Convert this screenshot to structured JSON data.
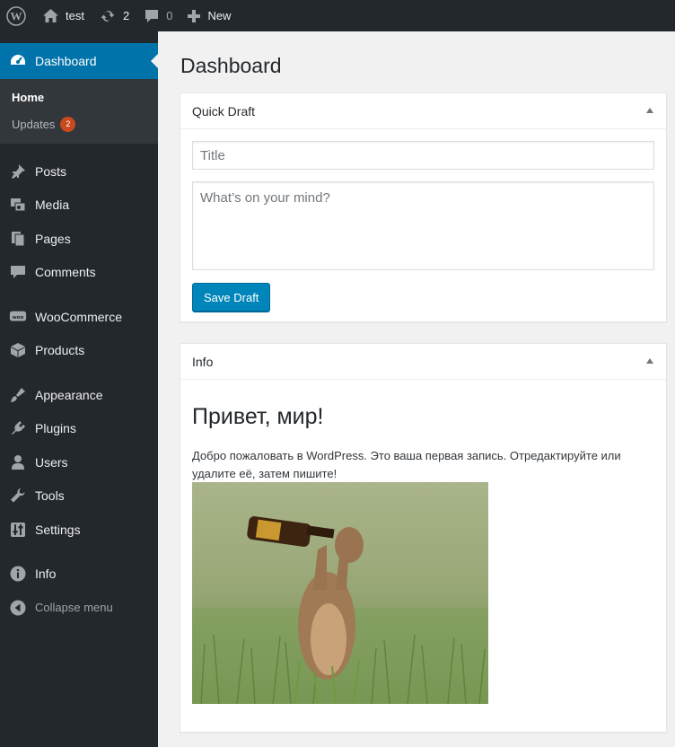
{
  "admin_bar": {
    "site_name": "test",
    "updates_count": "2",
    "comments_count": "0",
    "new_label": "New"
  },
  "sidebar": {
    "dashboard": "Dashboard",
    "submenu": {
      "home": "Home",
      "updates": "Updates",
      "updates_badge": "2"
    },
    "items": [
      {
        "label": "Posts",
        "icon": "pin-icon"
      },
      {
        "label": "Media",
        "icon": "media-icon"
      },
      {
        "label": "Pages",
        "icon": "pages-icon"
      },
      {
        "label": "Comments",
        "icon": "comments-icon"
      },
      {
        "label": "WooCommerce",
        "icon": "woocommerce-icon"
      },
      {
        "label": "Products",
        "icon": "products-icon"
      },
      {
        "label": "Appearance",
        "icon": "brush-icon"
      },
      {
        "label": "Plugins",
        "icon": "plugin-icon"
      },
      {
        "label": "Users",
        "icon": "users-icon"
      },
      {
        "label": "Tools",
        "icon": "wrench-icon"
      },
      {
        "label": "Settings",
        "icon": "settings-icon"
      },
      {
        "label": "Info",
        "icon": "info-icon"
      },
      {
        "label": "Collapse menu",
        "icon": "collapse-icon"
      }
    ]
  },
  "main": {
    "page_title": "Dashboard",
    "quick_draft": {
      "heading": "Quick Draft",
      "title_placeholder": "Title",
      "content_placeholder": "What’s on your mind?",
      "save_label": "Save Draft"
    },
    "info": {
      "heading": "Info",
      "post_title": "Привет, мир!",
      "post_text": "Добро пожаловать в WordPress. Это ваша первая запись. Отредактируйте или удалите её, затем пишите!"
    }
  },
  "colors": {
    "admin_bar": "#23282d",
    "accent": "#0073aa",
    "button": "#0085ba",
    "badge": "#ca4a1f"
  }
}
